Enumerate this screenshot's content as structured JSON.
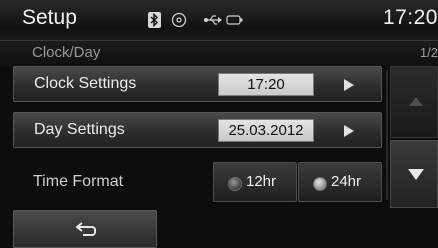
{
  "header": {
    "title": "Setup",
    "time": "17:20",
    "status_icons": [
      "bluetooth-icon",
      "disc-icon",
      "usb-icon",
      "battery-icon"
    ]
  },
  "subheader": {
    "title": "Clock/Day",
    "page": "1/2"
  },
  "menu": {
    "clock_settings": {
      "label": "Clock Settings",
      "value": "17:20"
    },
    "day_settings": {
      "label": "Day Settings",
      "value": "25.03.2012"
    },
    "time_format": {
      "label": "Time Format",
      "options": [
        "12hr",
        "24hr"
      ],
      "selected": "24hr"
    }
  },
  "scroll": {
    "up_icon": "arrow-up-icon",
    "down_icon": "arrow-down-icon"
  },
  "footer": {
    "back_icon": "back-arrow-icon"
  },
  "colors": {
    "background": "#0d0d0d",
    "row_gradient_top": "#4a4a4a",
    "value_box": "#d8d8d8",
    "text": "#eaeaea"
  }
}
